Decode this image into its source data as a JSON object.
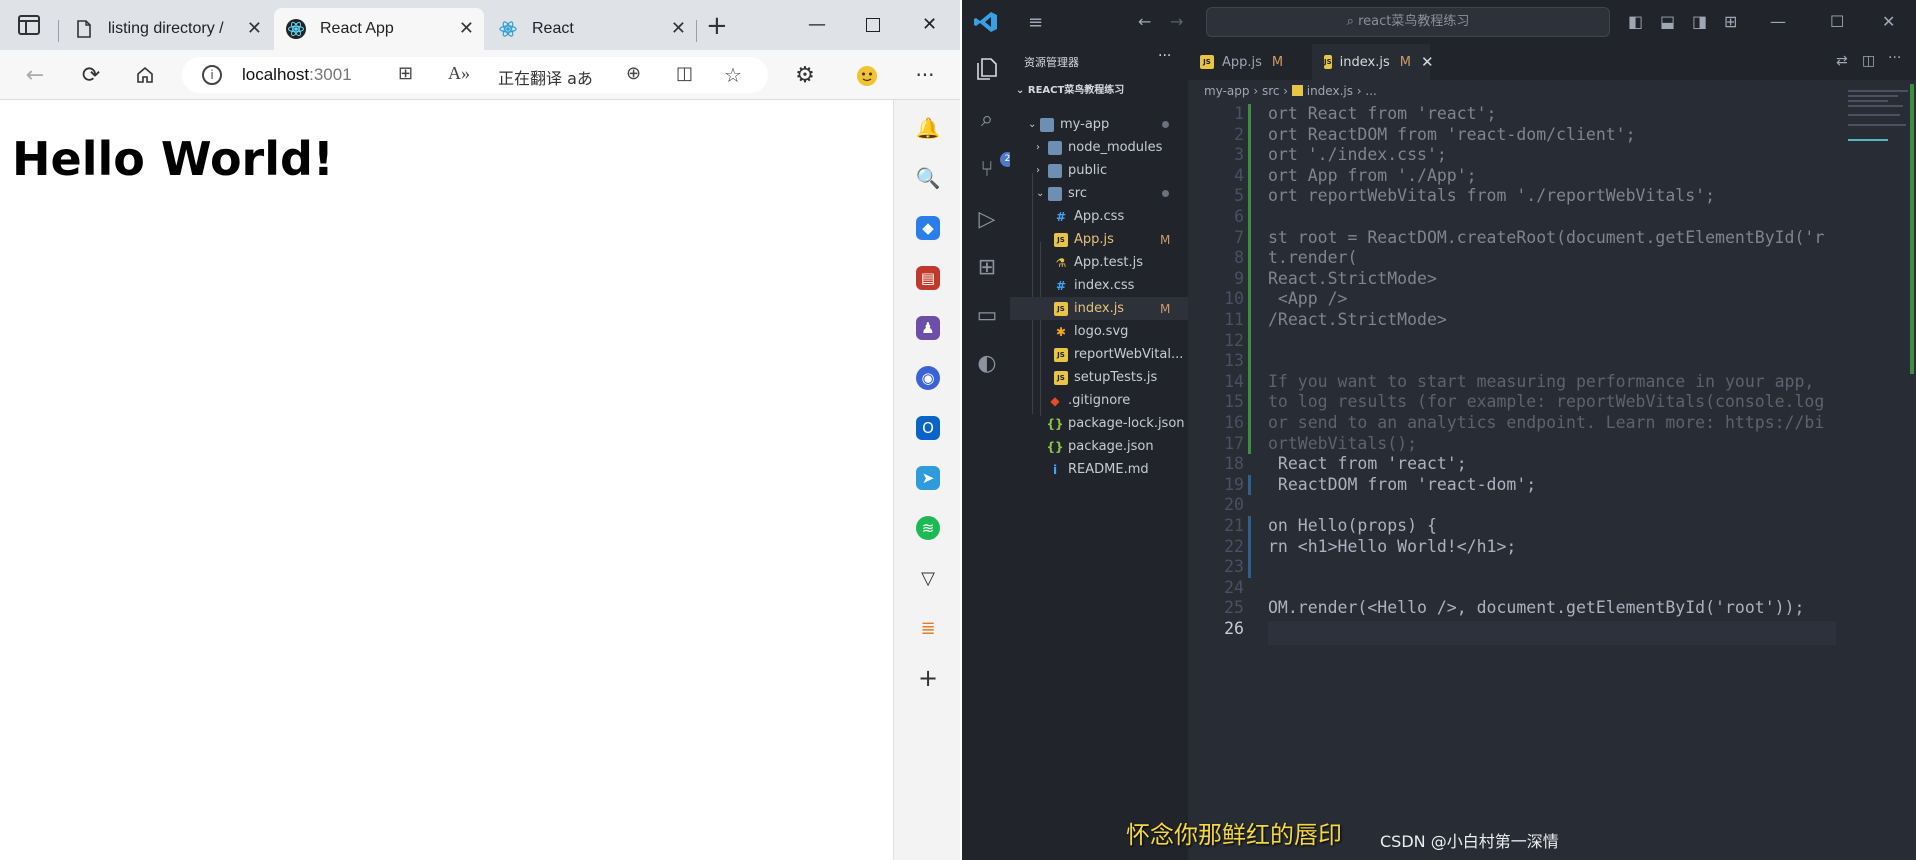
{
  "browser": {
    "tabs": [
      {
        "label": "listing directory /",
        "icon": "document-icon"
      },
      {
        "label": "React App",
        "icon": "react-icon"
      },
      {
        "label": "React",
        "icon": "react-icon"
      }
    ],
    "address": {
      "host": "localhost",
      "port": ":3001"
    },
    "translate_label": "正在翻译",
    "page_heading": "Hello World!"
  },
  "vscode": {
    "command_center": "react菜鸟教程练习",
    "explorer_title": "资源管理器",
    "root_folder": "REACT菜鸟教程练习",
    "tree": [
      {
        "name": "my-app",
        "kind": "folder-open",
        "depth": 0,
        "dot": true
      },
      {
        "name": "node_modules",
        "kind": "folder",
        "depth": 1
      },
      {
        "name": "public",
        "kind": "folder",
        "depth": 1
      },
      {
        "name": "src",
        "kind": "folder-open",
        "depth": 1,
        "dot": true
      },
      {
        "name": "App.css",
        "kind": "css",
        "depth": 2
      },
      {
        "name": "App.js",
        "kind": "js",
        "depth": 2,
        "mod": "M"
      },
      {
        "name": "App.test.js",
        "kind": "test",
        "depth": 2
      },
      {
        "name": "index.css",
        "kind": "css",
        "depth": 2
      },
      {
        "name": "index.js",
        "kind": "js",
        "depth": 2,
        "mod": "M",
        "selected": true
      },
      {
        "name": "logo.svg",
        "kind": "svg",
        "depth": 2
      },
      {
        "name": "reportWebVital...",
        "kind": "js",
        "depth": 2
      },
      {
        "name": "setupTests.js",
        "kind": "js",
        "depth": 2
      },
      {
        "name": ".gitignore",
        "kind": "git",
        "depth": 1
      },
      {
        "name": "package-lock.json",
        "kind": "json",
        "depth": 1
      },
      {
        "name": "package.json",
        "kind": "json",
        "depth": 1
      },
      {
        "name": "README.md",
        "kind": "info",
        "depth": 1
      }
    ],
    "editor_tabs": [
      {
        "label": "App.js",
        "mod": "M",
        "active": false
      },
      {
        "label": "index.js",
        "mod": "M",
        "active": true
      }
    ],
    "breadcrumb": [
      "my-app",
      "src",
      "index.js",
      "..."
    ],
    "code_lines": [
      {
        "n": "1",
        "text": "ort React from 'react';"
      },
      {
        "n": "2",
        "text": "ort ReactDOM from 'react-dom/client';"
      },
      {
        "n": "3",
        "text": "ort './index.css';"
      },
      {
        "n": "4",
        "text": "ort App from './App';"
      },
      {
        "n": "5",
        "text": "ort reportWebVitals from './reportWebVitals';"
      },
      {
        "n": "6",
        "text": ""
      },
      {
        "n": "7",
        "text": "st root = ReactDOM.createRoot(document.getElementById('r"
      },
      {
        "n": "8",
        "text": "t.render("
      },
      {
        "n": "9",
        "text": "React.StrictMode>"
      },
      {
        "n": "10",
        "text": " <App />"
      },
      {
        "n": "11",
        "text": "/React.StrictMode>"
      },
      {
        "n": "12",
        "text": ""
      },
      {
        "n": "13",
        "text": ""
      },
      {
        "n": "14",
        "text": "If you want to start measuring performance in your app,"
      },
      {
        "n": "15",
        "text": "to log results (for example: reportWebVitals(console.log"
      },
      {
        "n": "16",
        "text": "or send to an analytics endpoint. Learn more: https://bi"
      },
      {
        "n": "17",
        "text": "ortWebVitals();"
      },
      {
        "n": "18",
        "text": " React from 'react';"
      },
      {
        "n": "19",
        "text": " ReactDOM from 'react-dom';"
      },
      {
        "n": "20",
        "text": ""
      },
      {
        "n": "21",
        "text": "on Hello(props) {"
      },
      {
        "n": "22",
        "text": "rn <h1>Hello World!</h1>;"
      },
      {
        "n": "23",
        "text": ""
      },
      {
        "n": "24",
        "text": ""
      },
      {
        "n": "25",
        "text": "OM.render(<Hello />, document.getElementById('root'));"
      },
      {
        "n": "26",
        "text": ""
      }
    ]
  },
  "overlay": {
    "lyric": "怀念你那鲜红的唇印",
    "watermark": "CSDN @小白村第一深情"
  }
}
